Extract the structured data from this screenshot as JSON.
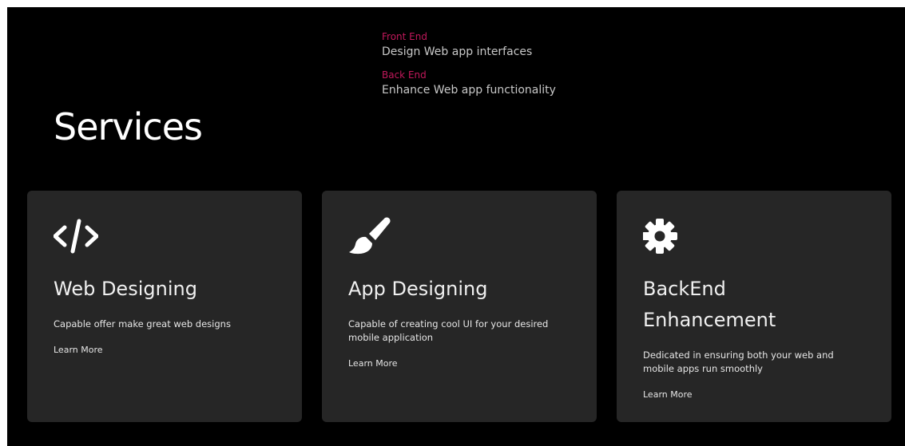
{
  "features": [
    {
      "label": "Front End",
      "description": "Design Web app interfaces"
    },
    {
      "label": "Back End",
      "description": "Enhance Web app functionality"
    }
  ],
  "section": {
    "title": "Services"
  },
  "cards": [
    {
      "icon": "code-icon",
      "title": "Web Designing",
      "text": "Capable offer make great web designs",
      "link": "Learn More"
    },
    {
      "icon": "brush-icon",
      "title": "App Designing",
      "text": "Capable of creating cool UI for your desired mobile application",
      "link": "Learn More"
    },
    {
      "icon": "gear-icon",
      "title": "BackEnd Enhancement",
      "text": "Dedicated in ensuring both your web and mobile apps run smoothly",
      "link": "Learn More"
    }
  ],
  "colors": {
    "background": "#000000",
    "card": "#262626",
    "accent": "#c2185b",
    "text": "#ffffff"
  }
}
